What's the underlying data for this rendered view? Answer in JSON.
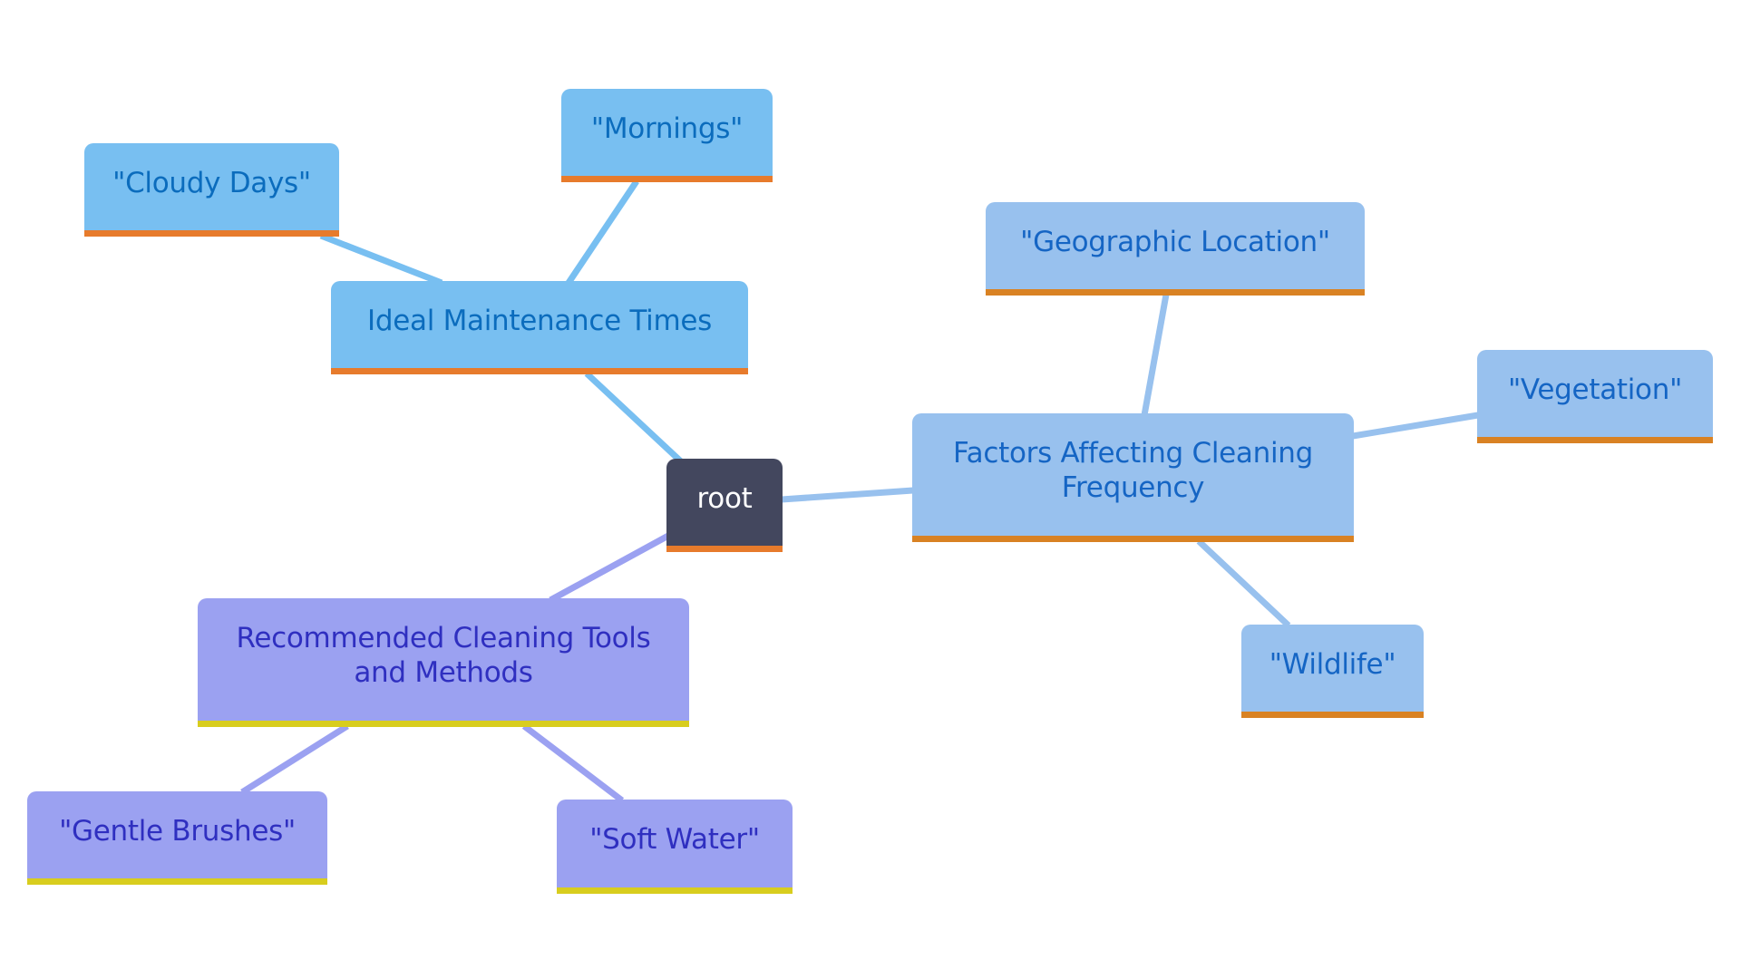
{
  "diagram": {
    "type": "mindmap",
    "root": {
      "id": "root",
      "label": "root"
    },
    "branches": [
      {
        "id": "ideal",
        "label": "Ideal Maintenance Times",
        "children": [
          {
            "id": "cloudy",
            "label": "\"Cloudy Days\""
          },
          {
            "id": "mornings",
            "label": "\"Mornings\""
          }
        ]
      },
      {
        "id": "factors",
        "label": "Factors Affecting Cleaning Frequency",
        "children": [
          {
            "id": "geo",
            "label": "\"Geographic Location\""
          },
          {
            "id": "veg",
            "label": "\"Vegetation\""
          },
          {
            "id": "wild",
            "label": "\"Wildlife\""
          }
        ]
      },
      {
        "id": "rec",
        "label": "Recommended Cleaning Tools and Methods",
        "children": [
          {
            "id": "gentle",
            "label": "\"Gentle Brushes\""
          },
          {
            "id": "soft",
            "label": "\"Soft Water\""
          }
        ]
      }
    ],
    "colors": {
      "root_fill": "#43475e",
      "ideal_fill": "#78bff1",
      "factors_fill": "#98c1ee",
      "recommended_fill": "#9ba1f1",
      "ideal_edge": "#78bff1",
      "factors_edge": "#98c1ee",
      "recommended_edge": "#9ba1f1",
      "accent_orange": "#e77b2c",
      "accent_yellow": "#d8cd1e"
    }
  }
}
